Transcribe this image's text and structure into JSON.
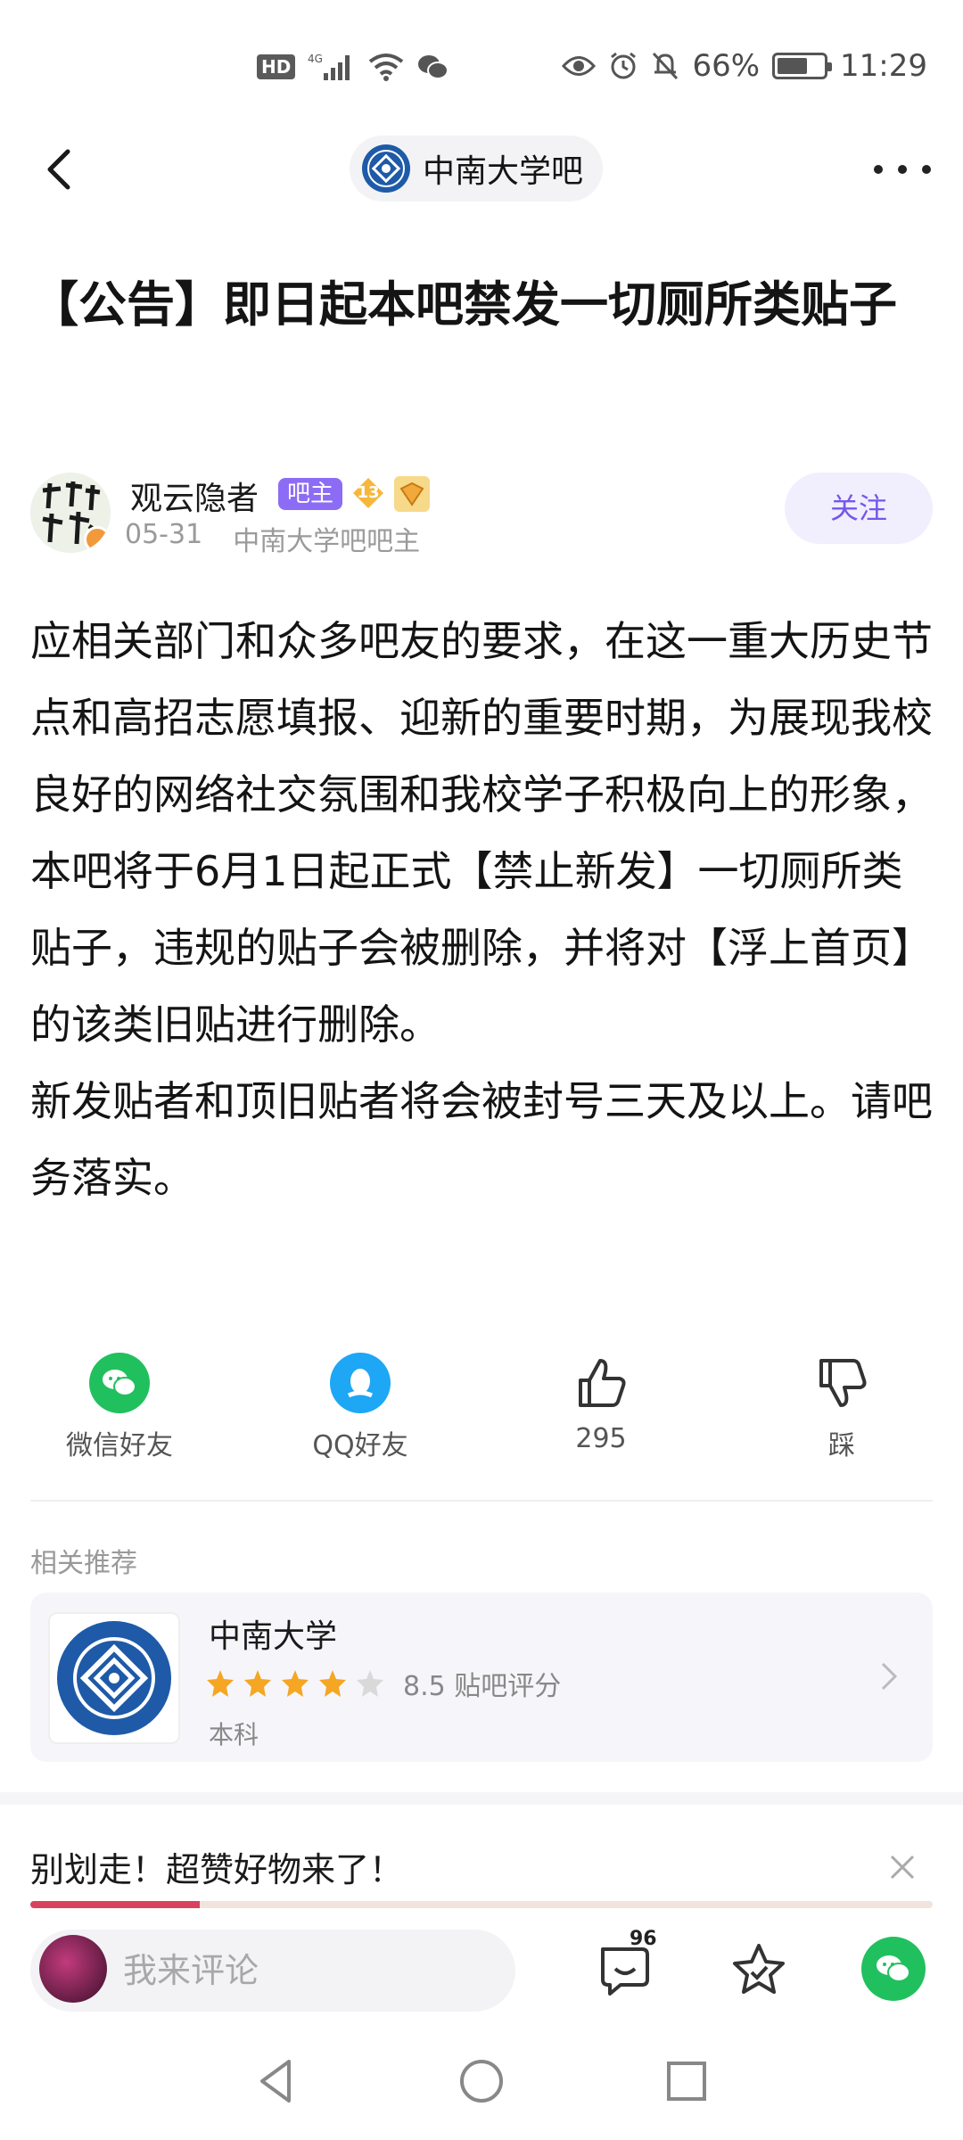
{
  "status_bar": {
    "hd": "HD",
    "network": "4G",
    "battery_percent": "66%",
    "battery_level": 0.66,
    "time": "11:29",
    "icons": [
      "hd-icon",
      "signal-icon",
      "wifi-icon",
      "wechat-notify-icon",
      "eye-icon",
      "alarm-icon",
      "mute-icon",
      "battery-icon"
    ]
  },
  "nav": {
    "forum_name": "中南大学吧"
  },
  "post": {
    "title": "【公告】即日起本吧禁发一切厕所类贴子",
    "author": {
      "name": "观云隐者",
      "badge": "吧主",
      "level": "13",
      "date": "05-31",
      "role": "中南大学吧吧主"
    },
    "follow_label": "关注",
    "body": "应相关部门和众多吧友的要求，在这一重大历史节点和高招志愿填报、迎新的重要时期，为展现我校良好的网络社交氛围和我校学子积极向上的形象，本吧将于6月1日起正式【禁止新发】一切厕所类贴子，违规的贴子会被删除，并将对【浮上首页】的该类旧贴进行删除。\n新发贴者和顶旧贴者将会被封号三天及以上。请吧务落实。"
  },
  "actions": {
    "wechat_label": "微信好友",
    "qq_label": "QQ好友",
    "like_count": "295",
    "dislike_label": "踩"
  },
  "related": {
    "label": "相关推荐",
    "card": {
      "name": "中南大学",
      "rating": 4,
      "rating_max": 5,
      "score_text": "8.5 贴吧评分",
      "type": "本科"
    }
  },
  "promo": {
    "text": "别划走！超赞好物来了！"
  },
  "bottom": {
    "comment_placeholder": "我来评论",
    "comment_count": "96"
  },
  "colors": {
    "accent_purple": "#7558e8",
    "admin_badge": "#8d6cf5",
    "wechat_green": "#21c05e",
    "qq_blue": "#1ea7f5",
    "star_orange": "#f5a623",
    "school_blue": "#1e5aa8"
  }
}
